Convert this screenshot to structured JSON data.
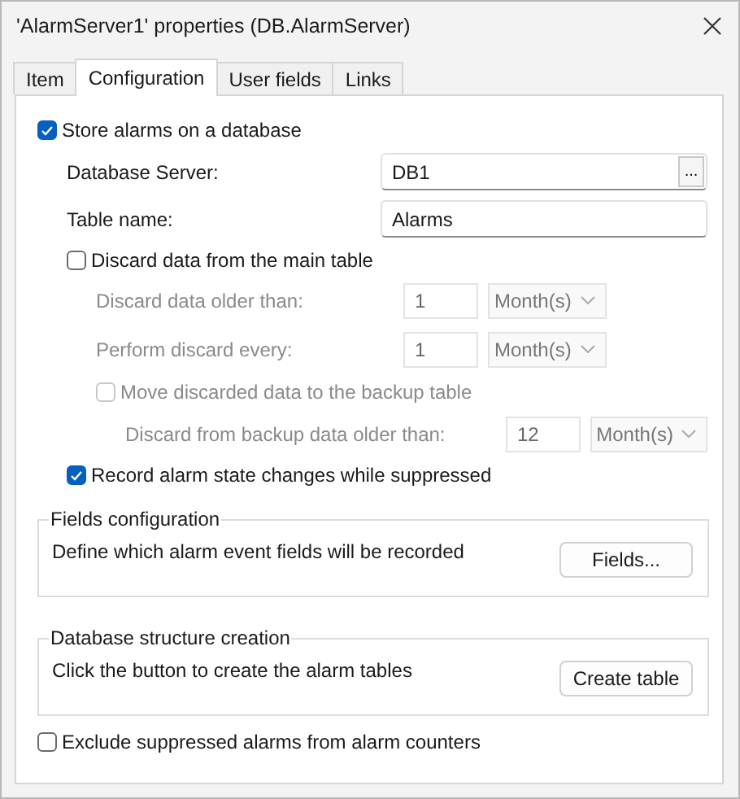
{
  "window": {
    "title": "'AlarmServer1' properties (DB.AlarmServer)"
  },
  "tabs": [
    {
      "label": "Item",
      "selected": false
    },
    {
      "label": "Configuration",
      "selected": true
    },
    {
      "label": "User fields",
      "selected": false
    },
    {
      "label": "Links",
      "selected": false
    }
  ],
  "store_option": {
    "label": "Store alarms on a database",
    "checked": true,
    "disabled": false
  },
  "database_server": {
    "label": "Database Server:",
    "value": "DB1",
    "browse_button": "..."
  },
  "table_name": {
    "label": "Table name:",
    "value": "Alarms"
  },
  "discard_option": {
    "label": "Discard data from the main table",
    "checked": false,
    "disabled": false
  },
  "discard_rows": [
    {
      "label": "Discard data older than:",
      "value": "1",
      "unit": "Month(s)",
      "disabled": true
    },
    {
      "label": "Perform discard every:",
      "value": "1",
      "unit": "Month(s)",
      "disabled": true
    }
  ],
  "backup_option": {
    "label": "Move discarded data to the backup table",
    "checked": false,
    "disabled": true
  },
  "backup_row": {
    "label": "Discard from backup data older than:",
    "value": "12",
    "unit": "Month(s)",
    "disabled": true
  },
  "record_option": {
    "label": "Record alarm state changes while suppressed",
    "checked": true,
    "disabled": false
  },
  "groups": [
    {
      "title": "Fields configuration",
      "description": "Define which alarm event fields will be recorded",
      "button": "Fields..."
    },
    {
      "title": "Database structure creation",
      "description": "Click the button to create the alarm tables",
      "button": "Create table"
    }
  ],
  "exclude_option": {
    "label": "Exclude suppressed alarms from alarm counters",
    "checked": false,
    "disabled": false
  }
}
